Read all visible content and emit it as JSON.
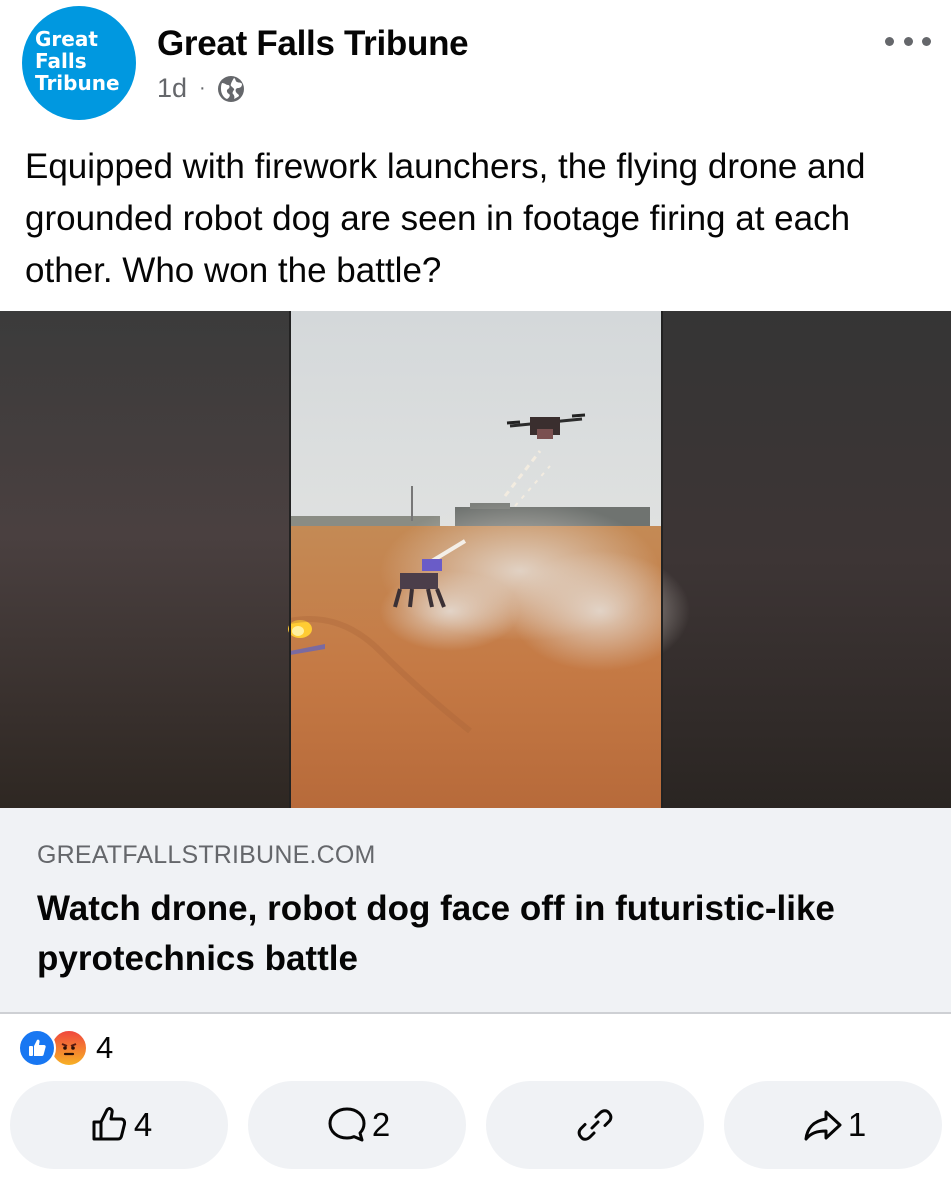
{
  "post": {
    "avatar_lines": [
      "Great",
      "Falls",
      "Tribune"
    ],
    "page_name": "Great Falls Tribune",
    "timestamp": "1d",
    "separator": "·",
    "privacy_icon": "globe-icon",
    "caption": "Equipped with firework launchers, the flying drone and grounded robot dog are seen in footage firing at each other. Who won the battle?"
  },
  "link_preview": {
    "domain": "GREATFALLSTRIBUNE.COM",
    "headline": "Watch drone, robot dog face off in futuristic-like pyrotechnics battle"
  },
  "reactions": {
    "types": [
      "like",
      "angry"
    ],
    "count": "4"
  },
  "actions": {
    "like_count": "4",
    "comment_count": "2",
    "share_count": "1"
  },
  "colors": {
    "brand_blue": "#0098e0",
    "facebook_blue": "#1877f2",
    "secondary_text": "#65676b",
    "card_background": "#f0f2f5"
  }
}
